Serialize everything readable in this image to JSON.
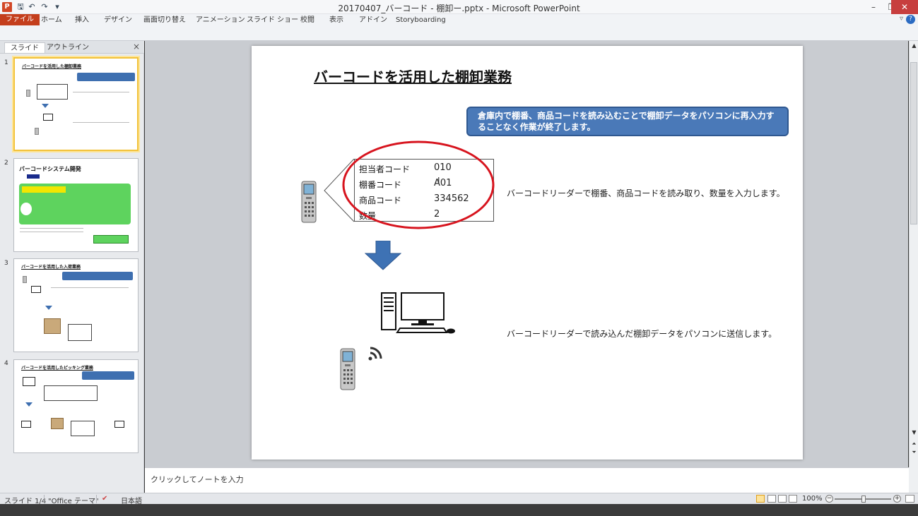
{
  "window": {
    "title": "20170407_バーコード - 棚卸ー.pptx - Microsoft PowerPoint",
    "logo_letter": "P",
    "minimize": "–",
    "restore": "❐",
    "close": "✕"
  },
  "quick_access": {
    "save": "🖫",
    "undo": "↶",
    "redo": "↷",
    "customize": "▾"
  },
  "ribbon": {
    "tabs": [
      "ファイル",
      "ホーム",
      "挿入",
      "デザイン",
      "画面切り替え",
      "アニメーション",
      "スライド ショー",
      "校閲",
      "表示",
      "アドイン",
      "Storyboarding"
    ],
    "collapse": "▿",
    "help": "?"
  },
  "left_panel": {
    "tab_slides": "スライド",
    "tab_outline": "アウトライン",
    "close": "×",
    "thumbnails": [
      {
        "num": "1",
        "title": "バーコードを活用した棚卸業務"
      },
      {
        "num": "2",
        "title": "バーコードシステム開発"
      },
      {
        "num": "3",
        "title": "バーコードを活用した入荷業務"
      },
      {
        "num": "4",
        "title": "バーコードを活用したピッキング業務"
      }
    ]
  },
  "slide": {
    "title": "バーコードを活用した棚卸業務",
    "callout": "倉庫内で棚番、商品コードを読み込むことで棚卸データをパソコンに再入力することなく作業が終了します。",
    "table": [
      {
        "label": "担当者コード",
        "value": "010"
      },
      {
        "label": "棚番コード",
        "value": "A01"
      },
      {
        "label": "商品コード",
        "value": "334562"
      },
      {
        "label": "数量",
        "value": "2"
      }
    ],
    "desc1": "バーコードリーダーで棚番、商品コードを読み取り、数量を入力します。",
    "desc2": "バーコードリーダーで読み込んだ棚卸データをパソコンに送信します。"
  },
  "notes": {
    "placeholder": "クリックしてノートを入力"
  },
  "status": {
    "slide_pos": "スライド 1/4",
    "theme": "\"Office テーマ\"",
    "language": "日本語",
    "zoom": "100%",
    "zoom_out": "−",
    "zoom_in": "+"
  },
  "colors": {
    "accent_blue": "#4a79b8",
    "ellipse_red": "#d7141e",
    "file_tab": "#c43e1c"
  }
}
